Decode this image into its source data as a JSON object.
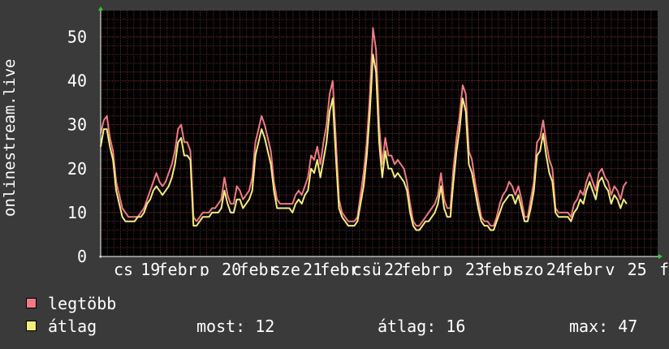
{
  "chart_data": {
    "type": "line",
    "ylabel": "onlinestream.live",
    "ylim": [
      0,
      56
    ],
    "y_ticks": [
      0,
      10,
      20,
      30,
      40,
      50
    ],
    "x_tick_labels": [
      "cs",
      "19",
      "febr",
      "p",
      "20",
      "febr",
      "sze",
      "21",
      "febr",
      "csü",
      "22",
      "febr",
      "p",
      "23",
      "febr",
      "szo",
      "24",
      "febr",
      "v",
      "25",
      "f"
    ],
    "grid": true,
    "x": [
      0,
      1,
      2,
      3,
      4,
      5,
      6,
      7,
      8,
      9,
      10,
      11,
      12,
      13,
      14,
      15,
      16,
      17,
      18,
      19,
      20,
      21,
      22,
      23,
      24,
      25,
      26,
      27,
      28,
      29,
      30,
      31,
      32,
      33,
      34,
      35,
      36,
      37,
      38,
      39,
      40,
      41,
      42,
      43,
      44,
      45,
      46,
      47,
      48,
      49,
      50,
      51,
      52,
      53,
      54,
      55,
      56,
      57,
      58,
      59,
      60,
      61,
      62,
      63,
      64,
      65,
      66,
      67,
      68,
      69,
      70,
      71,
      72,
      73,
      74,
      75,
      76,
      77,
      78,
      79,
      80,
      81,
      82,
      83,
      84,
      85,
      86,
      87,
      88,
      89,
      90,
      91,
      92,
      93,
      94,
      95,
      96,
      97,
      98,
      99,
      100,
      101,
      102,
      103,
      104,
      105,
      106,
      107,
      108,
      109,
      110,
      111,
      112,
      113,
      114,
      115,
      116,
      117,
      118,
      119,
      120,
      121,
      122,
      123,
      124,
      125,
      126,
      127,
      128,
      129,
      130,
      131,
      132,
      133,
      134,
      135,
      136,
      137,
      138,
      139,
      140,
      141,
      142,
      143,
      144,
      145,
      146,
      147,
      148,
      149,
      150,
      151,
      152,
      153,
      154,
      155,
      156,
      157,
      158,
      159,
      160,
      161,
      162,
      163,
      164,
      165,
      166,
      167,
      168,
      169,
      170,
      171,
      172,
      173,
      174,
      175,
      176,
      177,
      178,
      179,
      180
    ],
    "series": [
      {
        "name": "legtöbb",
        "color": "#f07a85",
        "values": [
          28,
          31,
          32,
          27,
          24,
          17,
          14,
          11,
          10,
          9,
          9,
          9,
          9,
          10,
          11,
          13,
          15,
          17,
          19,
          17,
          16,
          17,
          19,
          21,
          24,
          29,
          30,
          26,
          26,
          24,
          9,
          8,
          9,
          10,
          10,
          10,
          11,
          11,
          12,
          13,
          18,
          14,
          12,
          12,
          16,
          15,
          13,
          14,
          15,
          18,
          26,
          29,
          32,
          30,
          27,
          24,
          17,
          13,
          12,
          12,
          12,
          12,
          12,
          14,
          15,
          14,
          16,
          18,
          23,
          22,
          25,
          21,
          26,
          30,
          37,
          40,
          27,
          13,
          10,
          9,
          8,
          8,
          8,
          9,
          14,
          19,
          26,
          37,
          52,
          47,
          30,
          21,
          27,
          23,
          23,
          21,
          22,
          21,
          20,
          17,
          12,
          8,
          7,
          7,
          8,
          9,
          10,
          11,
          12,
          14,
          19,
          13,
          11,
          11,
          20,
          27,
          32,
          39,
          37,
          24,
          22,
          17,
          13,
          9,
          8,
          8,
          7,
          7,
          9,
          12,
          14,
          15,
          17,
          16,
          14,
          16,
          13,
          9,
          9,
          13,
          17,
          26,
          27,
          31,
          26,
          22,
          20,
          11,
          10,
          10,
          10,
          10,
          9,
          12,
          13,
          15,
          14,
          17,
          19,
          17,
          15,
          19,
          20,
          18,
          17,
          14,
          16,
          15,
          13,
          16,
          17
        ],
        "label_bind": "legend.max_label"
      },
      {
        "name": "átlag",
        "color": "#f2ee7d",
        "values": [
          25,
          29,
          29,
          25,
          22,
          15,
          12,
          9,
          8,
          8,
          8,
          8,
          9,
          9,
          10,
          12,
          13,
          15,
          16,
          15,
          14,
          15,
          16,
          18,
          21,
          26,
          27,
          23,
          23,
          22,
          7,
          7,
          8,
          9,
          9,
          9,
          10,
          10,
          10,
          11,
          15,
          12,
          10,
          10,
          13,
          13,
          11,
          12,
          13,
          15,
          23,
          26,
          29,
          27,
          24,
          21,
          15,
          11,
          11,
          11,
          11,
          11,
          10,
          12,
          13,
          12,
          14,
          15,
          20,
          19,
          22,
          18,
          22,
          26,
          33,
          36,
          23,
          11,
          9,
          8,
          7,
          7,
          7,
          8,
          12,
          16,
          23,
          33,
          46,
          42,
          26,
          18,
          24,
          20,
          20,
          18,
          19,
          18,
          17,
          15,
          10,
          7,
          6,
          6,
          7,
          8,
          8,
          9,
          10,
          12,
          16,
          11,
          9,
          9,
          17,
          24,
          29,
          36,
          33,
          21,
          19,
          15,
          11,
          8,
          7,
          7,
          6,
          6,
          8,
          10,
          12,
          13,
          14,
          14,
          12,
          14,
          11,
          8,
          8,
          11,
          15,
          23,
          24,
          28,
          23,
          19,
          17,
          10,
          9,
          9,
          9,
          9,
          8,
          10,
          11,
          13,
          12,
          15,
          17,
          15,
          13,
          17,
          18,
          16,
          15,
          12,
          14,
          13,
          11,
          13,
          12
        ],
        "label_bind": "legend.avg_label"
      }
    ]
  },
  "legend": {
    "max_label": "legtöbb",
    "avg_label": "átlag",
    "max_color": "#f07a85",
    "avg_color": "#f2ee7d"
  },
  "stats": {
    "most": "most: 12",
    "atlag": "átlag: 16",
    "max": "max: 47"
  }
}
